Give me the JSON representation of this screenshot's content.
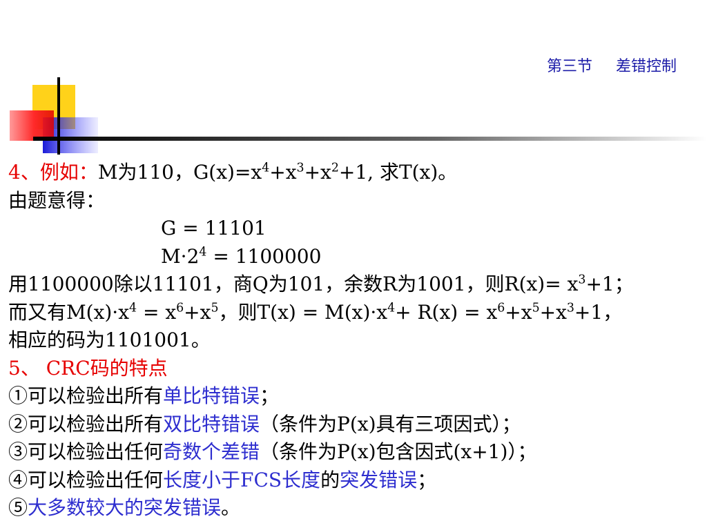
{
  "header": {
    "section": "第三节",
    "title": "差错控制"
  },
  "colors": {
    "accent_red": "#e60000",
    "accent_blue": "#2e2ecf",
    "header_blue": "#1c1ca8"
  },
  "example": {
    "label": "4、例如：",
    "t1": "M为110，G(x)=x",
    "e1": "4",
    "t2": "+x",
    "e2": "3",
    "t3": "+x",
    "e3": "2",
    "t4": "+1, 求T(x)。"
  },
  "given": "由题意得：",
  "g_line": "G = 11101",
  "m_line": {
    "t1": "M·2",
    "e1": "4",
    "t2": " = 1100000"
  },
  "r_line": {
    "t1": "用1100000除以11101，商Q为101，余数R为1001，则R(x)= x",
    "e1": "3",
    "t2": "+1；"
  },
  "t_line": {
    "t1": "而又有M(x)·x",
    "e1": "4",
    "t2": " = x",
    "e2": "6",
    "t3": "+x",
    "e3": "5",
    "t4": "，则T(x) = M(x)·x",
    "e4": "4",
    "t5": "+ R(x) = x",
    "e5": "6",
    "t6": "+x",
    "e6": "5",
    "t7": "+x",
    "e7": "3",
    "t8": "+1，"
  },
  "code_line": "相应的码为1101001。",
  "crc_heading": "5、 CRC码的特点",
  "features": [
    {
      "prefix": "①可以检验出所有",
      "hl": "单比特错误",
      "suffix": "；"
    },
    {
      "prefix": "②可以检验出所有",
      "hl": "双比特错误",
      "suffix": "（条件为P(x)具有三项因式）；"
    },
    {
      "prefix": "③可以检验出任何",
      "hl": "奇数个差错",
      "suffix": "（条件为P(x)包含因式(x+1)）；"
    },
    {
      "prefix": "④可以检验出任何",
      "hl": "长度小于FCS长度",
      "mid": "的",
      "hl2": "突发错误",
      "suffix": "；"
    },
    {
      "prefix": "⑤",
      "hl": "大多数较大的突发错误",
      "suffix": "。"
    }
  ]
}
